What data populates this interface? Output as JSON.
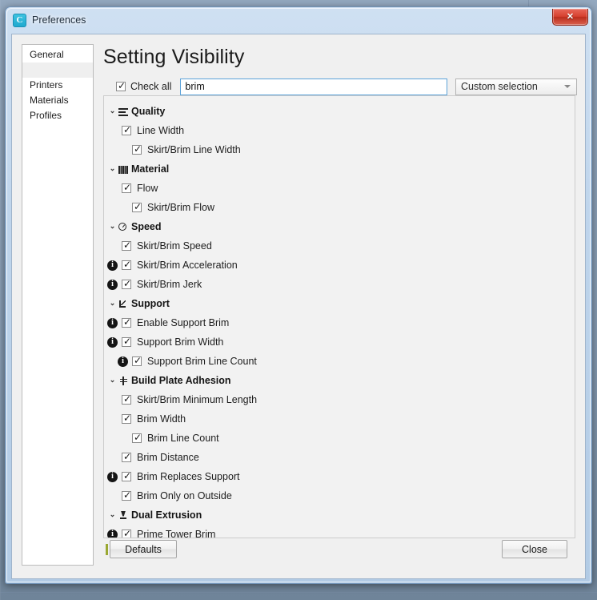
{
  "window": {
    "title": "Preferences",
    "logo_icon": "cura-logo-icon",
    "close_icon": "close-icon"
  },
  "sidebar": {
    "items": [
      {
        "label": "General",
        "selected": true
      },
      {
        "label": "Printers",
        "selected": false
      },
      {
        "label": "Materials",
        "selected": false
      },
      {
        "label": "Profiles",
        "selected": false
      }
    ]
  },
  "content": {
    "page_title": "Setting Visibility",
    "check_all": {
      "label": "Check all",
      "checked": true
    },
    "search": {
      "value": "brim",
      "placeholder": ""
    },
    "preset_dropdown": {
      "value": "Custom selection",
      "caret_icon": "chevron-down-icon"
    }
  },
  "tree": {
    "expander_glyph": "⌄",
    "rows": [
      {
        "type": "category",
        "label": "Quality",
        "icon": "quality-icon",
        "icon_class": "ic-quality",
        "expanded": true
      },
      {
        "type": "item",
        "label": "Line Width",
        "indent": 1,
        "checked": true,
        "info": false
      },
      {
        "type": "item",
        "label": "Skirt/Brim Line Width",
        "indent": 2,
        "checked": true,
        "info": false
      },
      {
        "type": "category",
        "label": "Material",
        "icon": "material-icon",
        "icon_class": "ic-material",
        "expanded": true
      },
      {
        "type": "item",
        "label": "Flow",
        "indent": 1,
        "checked": true,
        "info": false
      },
      {
        "type": "item",
        "label": "Skirt/Brim Flow",
        "indent": 2,
        "checked": true,
        "info": false
      },
      {
        "type": "category",
        "label": "Speed",
        "icon": "speed-icon",
        "icon_class": "ic-speed",
        "expanded": true
      },
      {
        "type": "item",
        "label": "Skirt/Brim Speed",
        "indent": 1,
        "checked": true,
        "info": false
      },
      {
        "type": "item",
        "label": "Skirt/Brim Acceleration",
        "indent": 1,
        "checked": true,
        "info": true
      },
      {
        "type": "item",
        "label": "Skirt/Brim Jerk",
        "indent": 1,
        "checked": true,
        "info": true
      },
      {
        "type": "category",
        "label": "Support",
        "icon": "support-icon",
        "icon_class": "ic-support",
        "expanded": true
      },
      {
        "type": "item",
        "label": "Enable Support Brim",
        "indent": 1,
        "checked": true,
        "info": true
      },
      {
        "type": "item",
        "label": "Support Brim Width",
        "indent": 1,
        "checked": true,
        "info": true
      },
      {
        "type": "item",
        "label": "Support Brim Line Count",
        "indent": 2,
        "checked": true,
        "info": true
      },
      {
        "type": "category",
        "label": "Build Plate Adhesion",
        "icon": "adhesion-icon",
        "icon_class": "ic-adhesion",
        "expanded": true
      },
      {
        "type": "item",
        "label": "Skirt/Brim Minimum Length",
        "indent": 1,
        "checked": true,
        "info": false
      },
      {
        "type": "item",
        "label": "Brim Width",
        "indent": 1,
        "checked": true,
        "info": false
      },
      {
        "type": "item",
        "label": "Brim Line Count",
        "indent": 2,
        "checked": true,
        "info": false
      },
      {
        "type": "item",
        "label": "Brim Distance",
        "indent": 1,
        "checked": true,
        "info": false
      },
      {
        "type": "item",
        "label": "Brim Replaces Support",
        "indent": 1,
        "checked": true,
        "info": true
      },
      {
        "type": "item",
        "label": "Brim Only on Outside",
        "indent": 1,
        "checked": true,
        "info": false
      },
      {
        "type": "category",
        "label": "Dual Extrusion",
        "icon": "dual-extrusion-icon",
        "icon_class": "ic-dual",
        "expanded": true
      },
      {
        "type": "item",
        "label": "Prime Tower Brim",
        "indent": 1,
        "checked": true,
        "info": true
      }
    ]
  },
  "footer": {
    "defaults_label": "Defaults",
    "close_label": "Close"
  }
}
